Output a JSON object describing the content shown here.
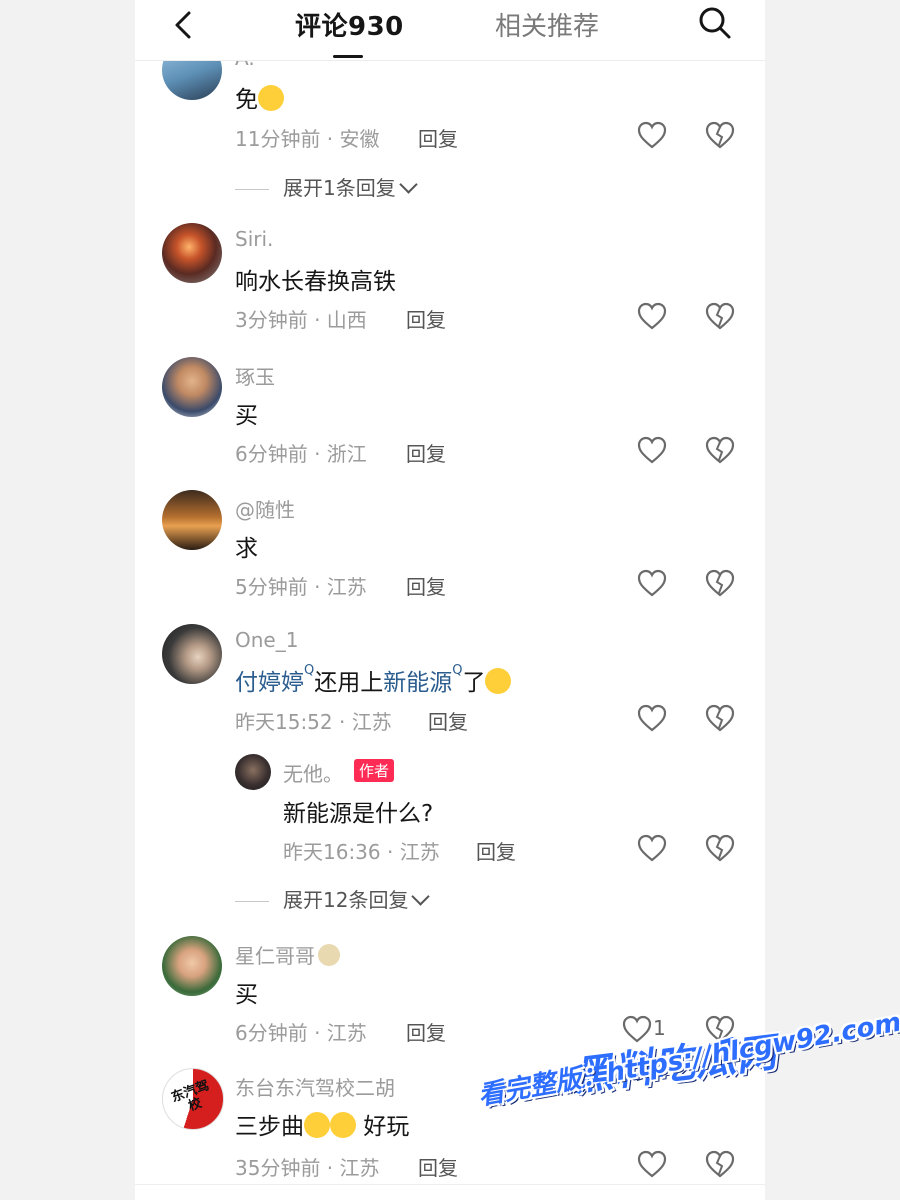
{
  "header": {
    "comments_tab": "评论930",
    "recommend_tab": "相关推荐"
  },
  "comments": [
    {
      "username": "A.",
      "text": "免",
      "time": "11分钟前 · 安徽",
      "reply": "回复",
      "expand": "展开1条回复"
    },
    {
      "username": "Siri.",
      "text": "响水长春换高铁",
      "time": "3分钟前 · 山西",
      "reply": "回复"
    },
    {
      "username": "琢玉",
      "text": "买",
      "time": "6分钟前 · 浙江",
      "reply": "回复"
    },
    {
      "username": "@随性",
      "text": "求",
      "time": "5分钟前 · 江苏",
      "reply": "回复"
    },
    {
      "username": "One_1",
      "text_link1": "付婷婷",
      "text_mid": "还用上",
      "text_link2": "新能源",
      "text_end": "了",
      "time": "昨天15:52 · 江苏",
      "reply": "回复",
      "sub_reply": {
        "username": "无他。",
        "badge": "作者",
        "text": "新能源是什么?",
        "time": "昨天16:36 · 江苏",
        "reply": "回复"
      },
      "expand": "展开12条回复"
    },
    {
      "username": "星仁哥哥",
      "text": "买",
      "time": "6分钟前 · 江苏",
      "reply": "回复",
      "likes": "1"
    },
    {
      "username": "东台东汽驾校二胡",
      "text_pre": "三步曲",
      "text_post": "好玩",
      "time": "35分钟前 · 江苏",
      "reply": "回复",
      "avatar_text": "东汽驾校"
    }
  ],
  "watermark": {
    "title": "黑料吃瓜网",
    "url": "看完整版：https://hlcgw92.com"
  },
  "colors": {
    "link": "#2c5d8f",
    "badge": "#fe2c55",
    "watermark": "#2d6dff"
  },
  "icons": [
    "back-arrow-icon",
    "search-icon",
    "heart-icon",
    "broken-heart-icon",
    "chevron-down-icon",
    "search-tag-icon"
  ]
}
